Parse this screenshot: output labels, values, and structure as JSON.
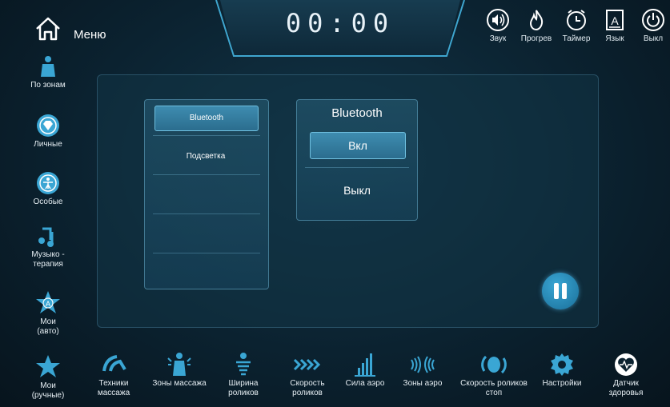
{
  "header": {
    "menu_label": "Меню",
    "timer": "00:00",
    "tools": [
      {
        "id": "sound",
        "label": "Звук",
        "icon": "speaker-icon"
      },
      {
        "id": "heat",
        "label": "Прогрев",
        "icon": "flame-icon"
      },
      {
        "id": "timer",
        "label": "Таймер",
        "icon": "clock-icon"
      },
      {
        "id": "language",
        "label": "Язык",
        "icon": "language-icon"
      },
      {
        "id": "power",
        "label": "Выкл",
        "icon": "power-icon"
      }
    ]
  },
  "sidebar": {
    "items": [
      {
        "label": "По зонам",
        "icon": "body-icon"
      },
      {
        "label": "Личные",
        "icon": "diamond-icon"
      },
      {
        "label": "Особые",
        "icon": "figure-circle-icon"
      },
      {
        "label": "Музыко - терапия",
        "icon": "music-note-icon"
      },
      {
        "label": "Мои (авто)",
        "icon": "star-a-icon"
      },
      {
        "label": "Мои (ручные)",
        "icon": "star-icon"
      }
    ]
  },
  "settings_list": {
    "items": [
      "Bluetooth",
      "Подсветка"
    ],
    "selected": "Bluetooth"
  },
  "bluetooth": {
    "title": "Bluetooth",
    "options": [
      "Вкл",
      "Выкл"
    ],
    "selected": "Вкл"
  },
  "bottom_bar": {
    "items": [
      {
        "label": "Техники массажа",
        "icon": "massage-technique-icon"
      },
      {
        "label": "Зоны массажа",
        "icon": "massage-zone-icon"
      },
      {
        "label": "Ширина роликов",
        "icon": "roller-width-icon"
      },
      {
        "label": "Скорость роликов",
        "icon": "roller-speed-icon"
      },
      {
        "label": "Сила аэро",
        "icon": "air-strength-icon"
      },
      {
        "label": "Зоны аэро",
        "icon": "air-zone-icon"
      },
      {
        "label": "Скорость роликов стоп",
        "icon": "foot-roller-speed-icon"
      },
      {
        "label": "Настройки",
        "icon": "gear-icon"
      },
      {
        "label": "Датчик здоровья",
        "icon": "heart-sensor-icon"
      }
    ]
  },
  "colors": {
    "accent": "#3aa6d4",
    "panel": "#1a4a63",
    "background": "#0b2230"
  }
}
